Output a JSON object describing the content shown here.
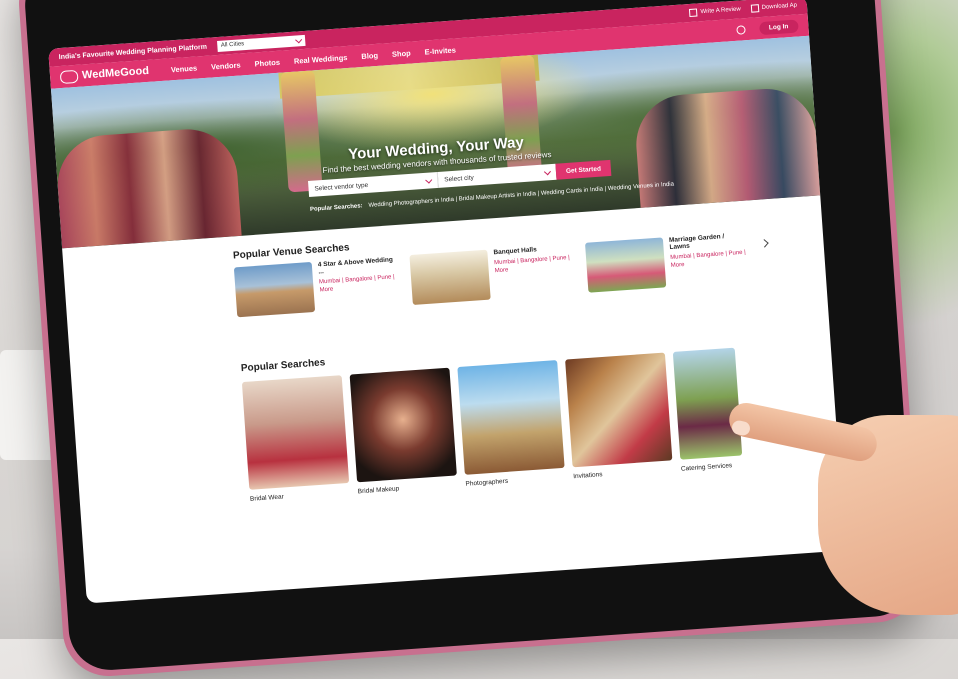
{
  "topbar": {
    "tagline": "India's Favourite Wedding Planning Platform",
    "city_select": "All Cities",
    "write_review": "Write A Review",
    "download_app": "Download Ap"
  },
  "navbar": {
    "brand": "WedMeGood",
    "items": [
      "Venues",
      "Vendors",
      "Photos",
      "Real Weddings",
      "Blog",
      "Shop",
      "E-Invites"
    ],
    "login": "Log In"
  },
  "hero": {
    "title": "Your Wedding, Your Way",
    "subtitle": "Find the best wedding vendors with thousands of trusted reviews",
    "vendor_type_placeholder": "Select vendor type",
    "city_placeholder": "Select city",
    "cta": "Get Started",
    "popular_label": "Popular Searches:",
    "popular_links": "Wedding Photographers in India | Bridal Makeup Artists in India | Wedding Cards in India | Wedding Venues in India"
  },
  "venue_section": {
    "title": "Popular Venue Searches",
    "venues": [
      {
        "name": "4 Star & Above Wedding ...",
        "cities": "Mumbai | Bangalore | Pune | More"
      },
      {
        "name": "Banquet Halls",
        "cities": "Mumbai | Bangalore | Pune | More"
      },
      {
        "name": "Marriage Garden / Lawns",
        "cities": "Mumbai | Bangalore | Pune | More"
      }
    ]
  },
  "search_section": {
    "title": "Popular Searches",
    "cards": [
      "Bridal Wear",
      "Bridal Makeup",
      "Photographers",
      "Invitations",
      "Catering Services"
    ]
  }
}
